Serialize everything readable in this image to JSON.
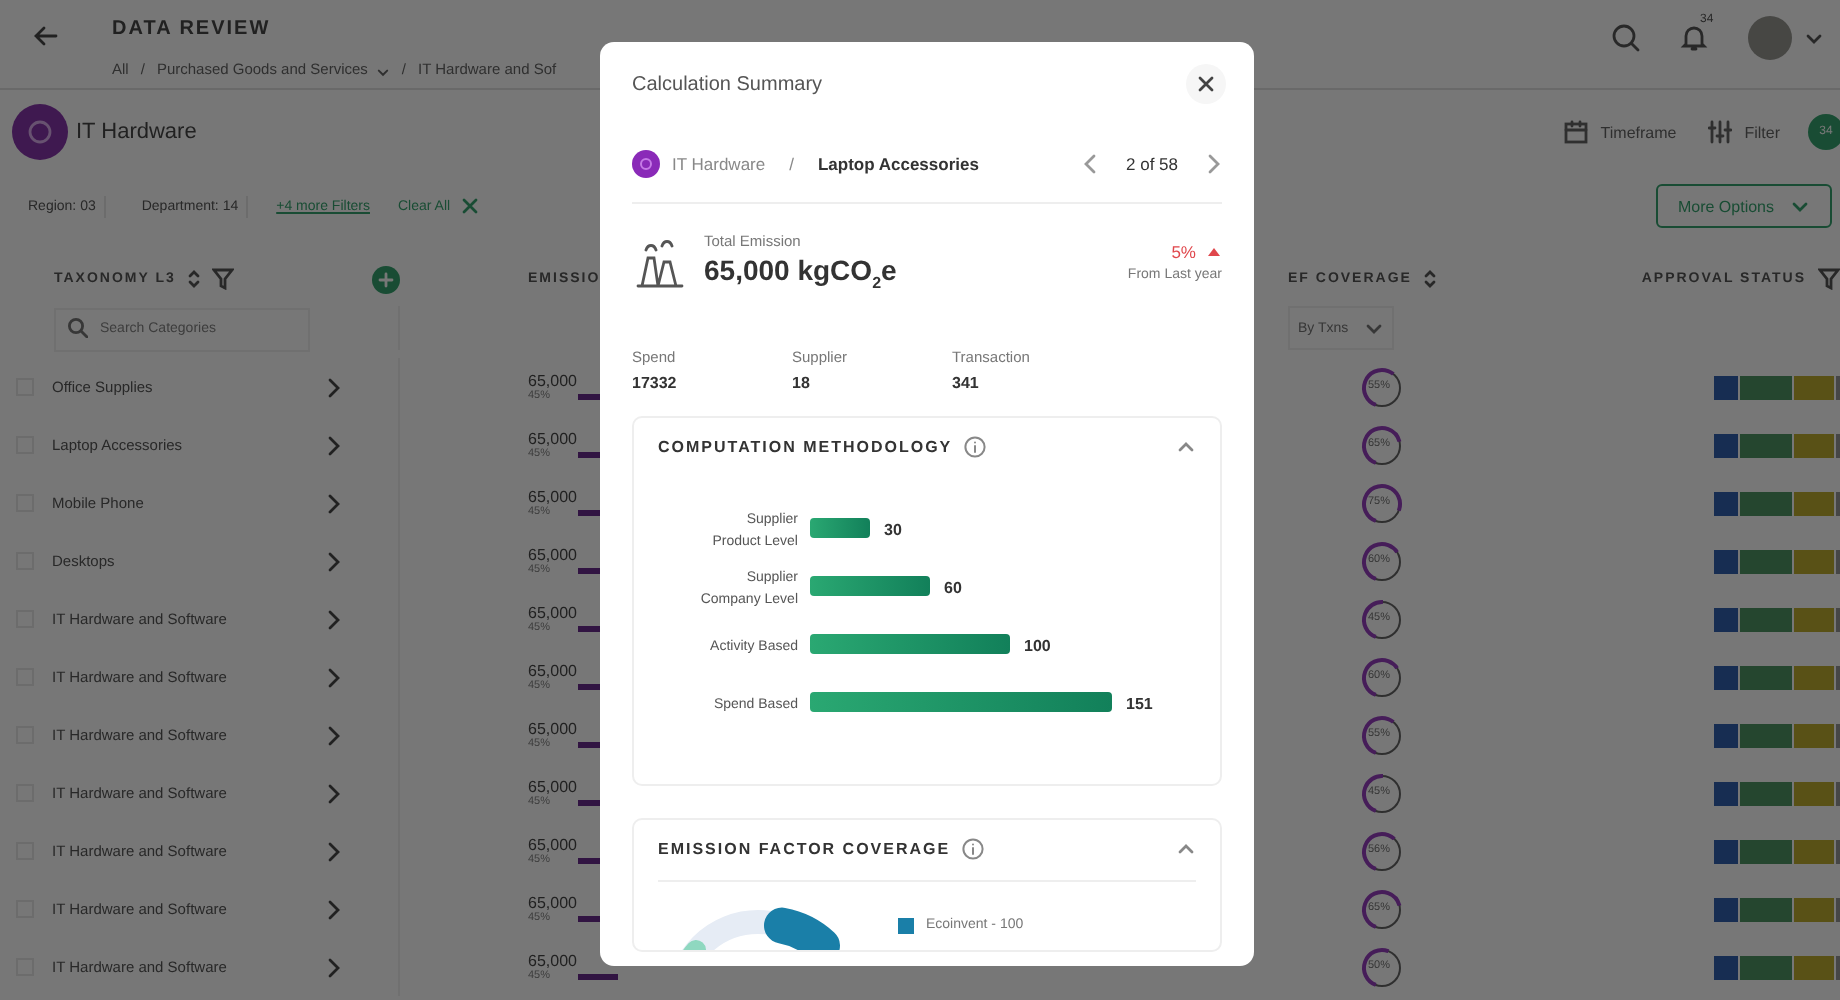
{
  "header": {
    "title": "DATA REVIEW",
    "breadcrumb": [
      {
        "label": "All",
        "dropdown": false
      },
      {
        "label": "Purchased Goods and Services",
        "dropdown": true
      },
      {
        "label": "IT Hardware and Sof",
        "dropdown": false
      }
    ],
    "separator": "/",
    "notification_count": "34"
  },
  "page": {
    "title": "IT Hardware",
    "actions": [
      {
        "kind": "timeframe",
        "label": "Timeframe"
      },
      {
        "kind": "filter",
        "label": "Filter"
      }
    ],
    "filter_badge": "34"
  },
  "filters": {
    "chips": [
      "Region: 03",
      "Department: 14"
    ],
    "more_link": "+4 more Filters",
    "clear": "Clear All",
    "more_options": "More Options"
  },
  "table": {
    "columns": [
      {
        "label": "TAXONOMY L3",
        "sort": true,
        "filter": true
      },
      {
        "label": "EMISSIO",
        "sort": false,
        "filter": false
      },
      {
        "label": "EF COVERAGE",
        "sort": true,
        "filter": false
      },
      {
        "label": "APPROVAL STATUS",
        "sort": false,
        "filter": true
      }
    ],
    "search_placeholder": "Search Categories",
    "coverage_dropdown": "By Txns",
    "rows": [
      {
        "name": "Office Supplies",
        "checked": false,
        "emission": "65,000",
        "share": "45%",
        "coverage": "55%",
        "level": 0.55
      },
      {
        "name": "Laptop Accessories",
        "checked": false,
        "emission": "65,000",
        "share": "45%",
        "coverage": "65%",
        "level": 0.65
      },
      {
        "name": "Mobile Phone",
        "checked": false,
        "emission": "65,000",
        "share": "45%",
        "coverage": "75%",
        "level": 0.75
      },
      {
        "name": "Desktops",
        "checked": false,
        "emission": "65,000",
        "share": "45%",
        "coverage": "60%",
        "level": 0.6
      },
      {
        "name": "IT Hardware and Software",
        "checked": false,
        "emission": "65,000",
        "share": "45%",
        "coverage": "45%",
        "level": 0.45
      },
      {
        "name": "IT Hardware and Software",
        "checked": false,
        "emission": "65,000",
        "share": "45%",
        "coverage": "60%",
        "level": 0.6
      },
      {
        "name": "IT Hardware and Software",
        "checked": false,
        "emission": "65,000",
        "share": "45%",
        "coverage": "55%",
        "level": 0.55
      },
      {
        "name": "IT Hardware and Software",
        "checked": false,
        "emission": "65,000",
        "share": "45%",
        "coverage": "45%",
        "level": 0.45
      },
      {
        "name": "IT Hardware and Software",
        "checked": false,
        "emission": "65,000",
        "share": "45%",
        "coverage": "56%",
        "level": 0.56
      },
      {
        "name": "IT Hardware and Software",
        "checked": false,
        "emission": "65,000",
        "share": "45%",
        "coverage": "65%",
        "level": 0.65
      },
      {
        "name": "IT Hardware and Software",
        "checked": false,
        "emission": "65,000",
        "share": "45%",
        "coverage": "50%",
        "level": 0.5
      }
    ]
  },
  "modal": {
    "title": "Calculation Summary",
    "path": {
      "parent": "IT Hardware",
      "separator": "/",
      "current": "Laptop Accessories"
    },
    "pager": "2 of 58",
    "total": {
      "label": "Total Emission",
      "value": "65,000 kgCO$_{2}$e",
      "change": "5%",
      "change_caption": "From Last year"
    },
    "stats": [
      {
        "label": "Spend",
        "value": "17332"
      },
      {
        "label": "Supplier",
        "value": "18"
      },
      {
        "label": "Transaction",
        "value": "341"
      }
    ],
    "cards": [
      {
        "title": "COMPUTATION METHODOLOGY",
        "expanded": true,
        "chart_data": {
          "type": "bar",
          "orientation": "horizontal",
          "categories": [
            "Supplier Product Level",
            "Supplier Company Level",
            "Activity Based",
            "Spend Based"
          ],
          "values": [
            30,
            60,
            100,
            151
          ],
          "data_labels": true
        }
      },
      {
        "title": "EMISSION FACTOR COVERAGE",
        "expanded": true,
        "legend": [
          {
            "label": "Ecoinvent - 100",
            "color": "#1a7fa8"
          }
        ]
      }
    ]
  }
}
